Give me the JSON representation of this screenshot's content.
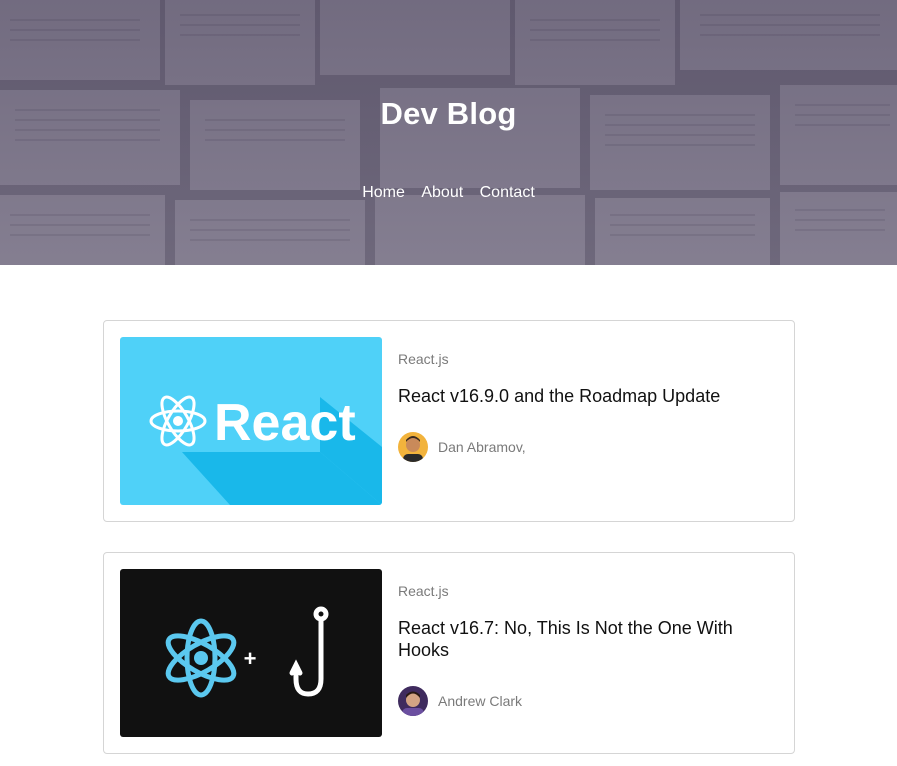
{
  "header": {
    "title": "Dev Blog",
    "nav": [
      "Home",
      "About",
      "Contact"
    ]
  },
  "posts": [
    {
      "category": "React.js",
      "title": "React v16.9.0 and the Roadmap Update",
      "author": "Dan Abramov,",
      "thumb_text": "React",
      "thumb_bg": "#4fd1f8"
    },
    {
      "category": "React.js",
      "title": "React v16.7: No, This Is Not the One With Hooks",
      "author": "Andrew Clark",
      "thumb_bg": "#111111",
      "thumb_symbol": "+"
    }
  ],
  "colors": {
    "react_blue": "#61dafb",
    "overlay": "#4a3f5e"
  }
}
